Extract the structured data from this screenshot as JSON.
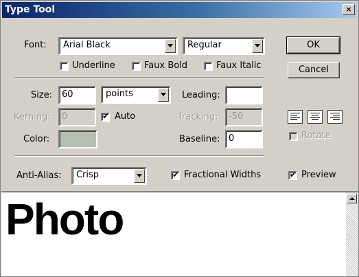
{
  "window": {
    "title": "Type Tool",
    "close_glyph": "×"
  },
  "font": {
    "label": "Font:",
    "family": "Arial Black",
    "style": "Regular"
  },
  "buttons": {
    "ok": "OK",
    "cancel": "Cancel"
  },
  "styles": {
    "underline": "Underline",
    "faux_bold": "Faux Bold",
    "faux_italic": "Faux Italic"
  },
  "size": {
    "label": "Size:",
    "value": "60",
    "unit": "points"
  },
  "leading": {
    "label": "Leading:",
    "value": ""
  },
  "kerning": {
    "label": "Kerning:",
    "value": "0",
    "auto_label": "Auto",
    "auto_checked": true
  },
  "tracking": {
    "label": "Tracking:",
    "value": "-50"
  },
  "color": {
    "label": "Color:",
    "swatch": "#b4c0b0"
  },
  "baseline": {
    "label": "Baseline:",
    "value": "0"
  },
  "rotate": {
    "label": "Rotate",
    "checked": false
  },
  "anti_alias": {
    "label": "Anti-Alias:",
    "value": "Crisp"
  },
  "fractional_widths": {
    "label": "Fractional Widths",
    "checked": true
  },
  "preview_opt": {
    "label": "Preview",
    "checked": true
  },
  "preview_text": "Photo",
  "icons": {
    "align_left": "align-left-icon",
    "align_center": "align-center-icon",
    "align_right": "align-right-icon"
  }
}
